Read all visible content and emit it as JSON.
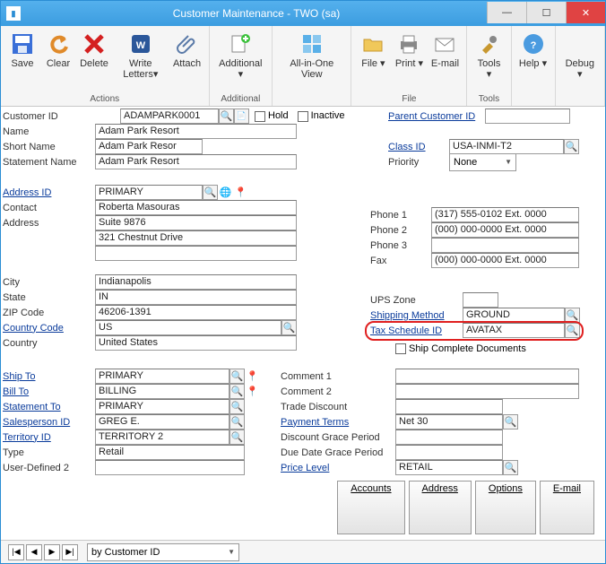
{
  "title": "Customer Maintenance  -  TWO (sa)",
  "ribbon": {
    "actions": {
      "save": "Save",
      "clear": "Clear",
      "delete": "Delete",
      "write": "Write Letters▾",
      "attach": "Attach",
      "caption": "Actions"
    },
    "additional": {
      "add": "Additional ▾",
      "caption": "Additional"
    },
    "view": {
      "aio": "All-in-One View"
    },
    "file": {
      "file": "File ▾",
      "print": "Print ▾",
      "email": "E-mail",
      "caption": "File"
    },
    "tools": {
      "tools": "Tools ▾",
      "caption": "Tools"
    },
    "help": {
      "help": "Help ▾"
    },
    "debug": {
      "debug": "Debug ▾"
    }
  },
  "labels": {
    "customer_id": "Customer ID",
    "hold": "Hold",
    "inactive": "Inactive",
    "parent": "Parent Customer ID",
    "name": "Name",
    "short": "Short Name",
    "stmt": "Statement Name",
    "class_id": "Class ID",
    "priority": "Priority",
    "address_id": "Address ID",
    "contact": "Contact",
    "address": "Address",
    "city": "City",
    "state": "State",
    "zip": "ZIP Code",
    "ccode": "Country Code",
    "country": "Country",
    "phone1": "Phone 1",
    "phone2": "Phone 2",
    "phone3": "Phone 3",
    "fax": "Fax",
    "ups": "UPS Zone",
    "shipm": "Shipping Method",
    "taxsched": "Tax Schedule ID",
    "shipcomp": "Ship Complete Documents",
    "shipto": "Ship To",
    "billto": "Bill To",
    "stmtto": "Statement To",
    "salesp": "Salesperson ID",
    "terr": "Territory ID",
    "type": "Type",
    "ud2": "User-Defined 2",
    "c1": "Comment 1",
    "c2": "Comment 2",
    "tdisc": "Trade Discount",
    "pterms": "Payment Terms",
    "dgp": "Discount Grace Period",
    "ddgp": "Due Date Grace Period",
    "plevel": "Price Level",
    "accounts": "Accounts",
    "addrbtn": "Address",
    "options": "Options",
    "emailbtn": "E-mail",
    "nav_by": "by Customer ID"
  },
  "values": {
    "customer_id": "ADAMPARK0001",
    "name": "Adam Park Resort",
    "short": "Adam Park Resor",
    "stmt": "Adam Park Resort",
    "class_id": "USA-INMI-T2",
    "priority": "None",
    "address_id": "PRIMARY",
    "contact": "Roberta Masouras",
    "addr1": "Suite 9876",
    "addr2": "321 Chestnut Drive",
    "city": "Indianapolis",
    "state": "IN",
    "zip": "46206-1391",
    "ccode": "US",
    "country": "United States",
    "phone1": "(317) 555-0102  Ext. 0000",
    "phone2": "(000) 000-0000  Ext. 0000",
    "phone3": "",
    "fax": "(000) 000-0000  Ext. 0000",
    "ups": "",
    "shipm": "GROUND",
    "taxsched": "AVATAX",
    "shipto": "PRIMARY",
    "billto": "BILLING",
    "stmtto": "PRIMARY",
    "salesp": "GREG E.",
    "terr": "TERRITORY 2",
    "type": "Retail",
    "ud2": "",
    "c1": "",
    "c2": "",
    "tdisc": "",
    "pterms": "Net 30",
    "dgp": "",
    "ddgp": "",
    "plevel": "RETAIL"
  }
}
